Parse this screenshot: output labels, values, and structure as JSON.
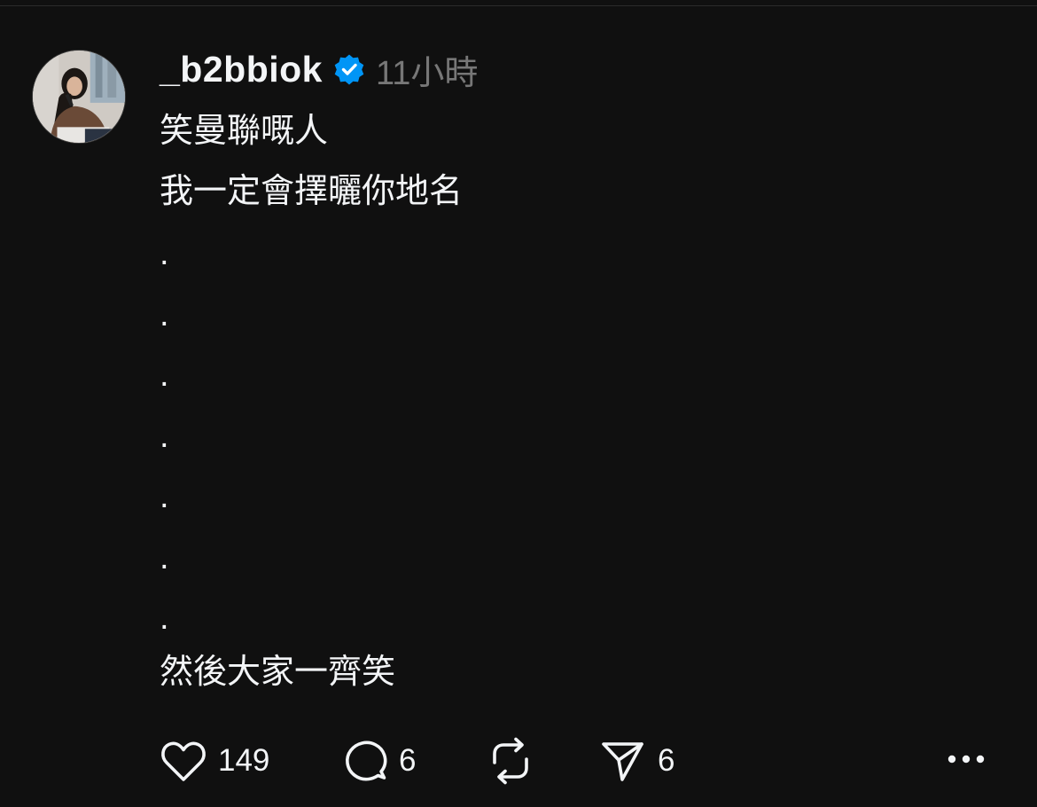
{
  "colors": {
    "background": "#101010",
    "text": "#f3f5f7",
    "muted": "#777777",
    "verified": "#0095f6"
  },
  "post": {
    "username": "_b2bbiok",
    "timestamp": "11小時",
    "verified": true,
    "lines_top": [
      "笑曼聯嘅人",
      "我一定會擇曬你地名"
    ],
    "dots": [
      ".",
      ".",
      ".",
      ".",
      ".",
      ".",
      "."
    ],
    "line_bottom": "然後大家一齊笑"
  },
  "actions": {
    "like": {
      "icon": "heart-icon",
      "count": "149"
    },
    "comment": {
      "icon": "comment-bubble-icon",
      "count": "6"
    },
    "repost": {
      "icon": "repost-icon",
      "count": ""
    },
    "share": {
      "icon": "send-icon",
      "count": "6"
    },
    "more": {
      "icon": "more-dots-icon"
    }
  }
}
